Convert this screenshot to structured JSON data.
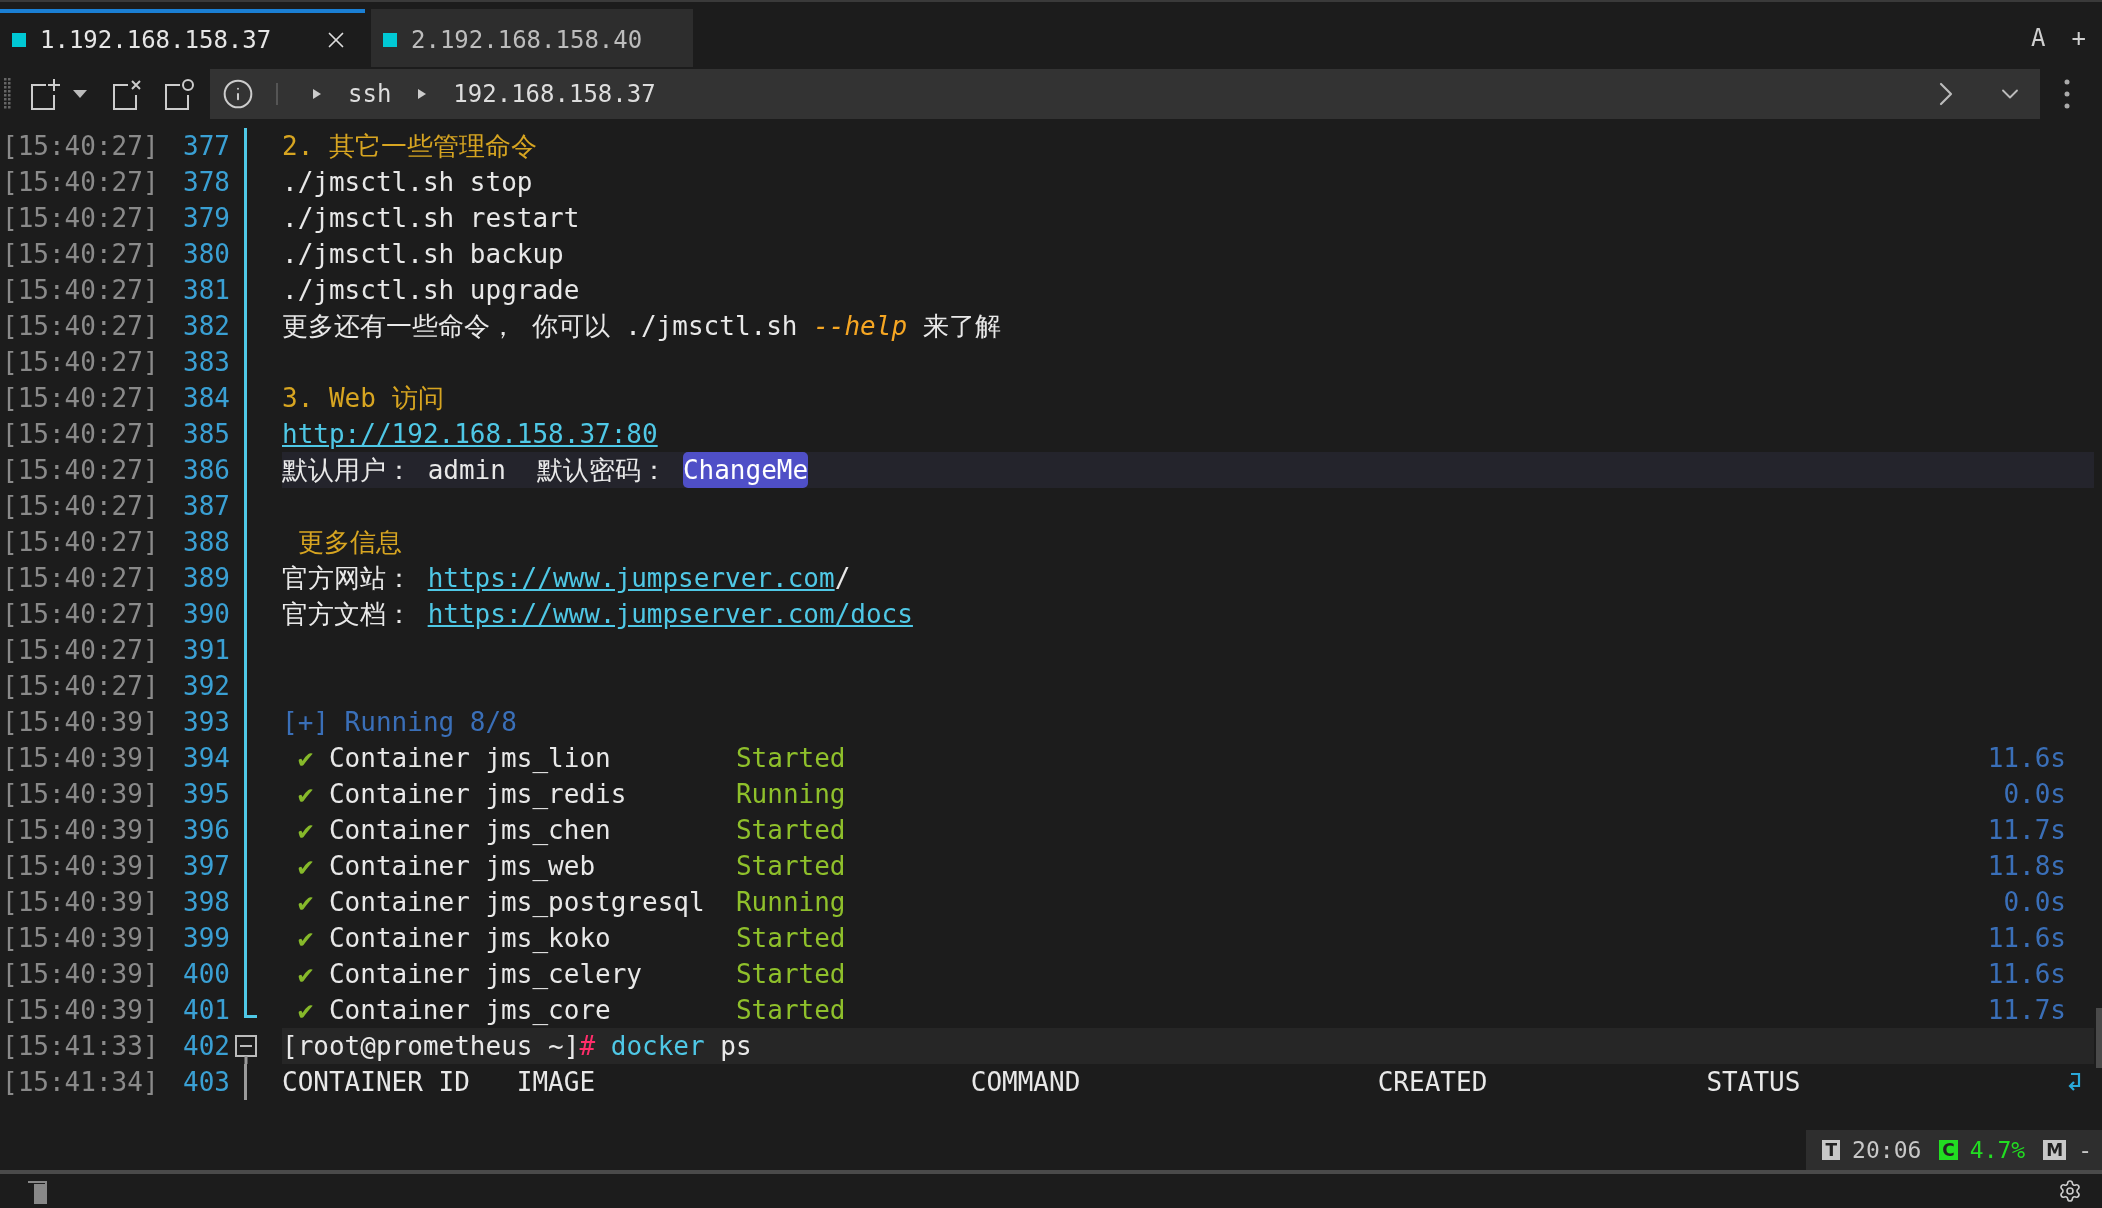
{
  "tabs": [
    {
      "label": "1.192.168.158.37",
      "selected": true,
      "closable": true
    },
    {
      "label": "2.192.168.158.40",
      "selected": false,
      "closable": false
    }
  ],
  "tab_actions": [
    "A",
    "+"
  ],
  "breadcrumb": [
    "ssh",
    "192.168.158.37"
  ],
  "lines": [
    {
      "time": "[15:40:27]",
      "number": "377",
      "kind": "text",
      "segments": [
        {
          "kind": "heading",
          "text": "2. 其它一些管理命令"
        }
      ]
    },
    {
      "time": "[15:40:27]",
      "number": "378",
      "kind": "text",
      "segments": [
        {
          "kind": "plain",
          "text": "./jmsctl.sh stop"
        }
      ]
    },
    {
      "time": "[15:40:27]",
      "number": "379",
      "kind": "text",
      "segments": [
        {
          "kind": "plain",
          "text": "./jmsctl.sh restart"
        }
      ]
    },
    {
      "time": "[15:40:27]",
      "number": "380",
      "kind": "text",
      "segments": [
        {
          "kind": "plain",
          "text": "./jmsctl.sh backup"
        }
      ]
    },
    {
      "time": "[15:40:27]",
      "number": "381",
      "kind": "text",
      "segments": [
        {
          "kind": "plain",
          "text": "./jmsctl.sh upgrade"
        }
      ]
    },
    {
      "time": "[15:40:27]",
      "number": "382",
      "kind": "text",
      "segments": [
        {
          "kind": "plain",
          "text": "更多还有一些命令， 你可以 ./jmsctl.sh "
        },
        {
          "kind": "flag",
          "text": "--help"
        },
        {
          "kind": "plain",
          "text": " 来了解"
        }
      ]
    },
    {
      "time": "[15:40:27]",
      "number": "383",
      "kind": "text"
    },
    {
      "time": "[15:40:27]",
      "number": "384",
      "kind": "text",
      "segments": [
        {
          "kind": "heading",
          "text": "3. Web 访问"
        }
      ]
    },
    {
      "time": "[15:40:27]",
      "number": "385",
      "kind": "text",
      "segments": [
        {
          "kind": "link",
          "text": "http://192.168.158.37:80"
        }
      ]
    },
    {
      "time": "[15:40:27]",
      "number": "386",
      "kind": "text",
      "highlighted": true,
      "segments": [
        {
          "kind": "plain",
          "text": "默认用户： admin  默认密码： "
        },
        {
          "kind": "selection",
          "text": "ChangeMe"
        }
      ]
    },
    {
      "time": "[15:40:27]",
      "number": "387",
      "kind": "text"
    },
    {
      "time": "[15:40:27]",
      "number": "388",
      "kind": "text",
      "segments": [
        {
          "kind": "heading",
          "text": " 更多信息"
        }
      ]
    },
    {
      "time": "[15:40:27]",
      "number": "389",
      "kind": "text",
      "segments": [
        {
          "kind": "plain",
          "text": "官方网站： "
        },
        {
          "kind": "link",
          "text": "https://www.jumpserver.com"
        },
        {
          "kind": "plain",
          "text": "/"
        }
      ]
    },
    {
      "time": "[15:40:27]",
      "number": "390",
      "kind": "text",
      "segments": [
        {
          "kind": "plain",
          "text": "官方文档： "
        },
        {
          "kind": "link",
          "text": "https://www.jumpserver.com/docs"
        }
      ]
    },
    {
      "time": "[15:40:27]",
      "number": "391",
      "kind": "text"
    },
    {
      "time": "[15:40:27]",
      "number": "392",
      "kind": "text"
    },
    {
      "time": "[15:40:39]",
      "number": "393",
      "kind": "text",
      "segments": [
        {
          "kind": "progress",
          "text": "[+] Running 8/8"
        }
      ]
    },
    {
      "time": "[15:40:39]",
      "number": "394",
      "kind": "container",
      "mark": "✔",
      "name": "Container jms_lion",
      "status": "Started",
      "duration": "11.6s"
    },
    {
      "time": "[15:40:39]",
      "number": "395",
      "kind": "container",
      "mark": "✔",
      "name": "Container jms_redis",
      "status": "Running",
      "duration": "0.0s"
    },
    {
      "time": "[15:40:39]",
      "number": "396",
      "kind": "container",
      "mark": "✔",
      "name": "Container jms_chen",
      "status": "Started",
      "duration": "11.7s"
    },
    {
      "time": "[15:40:39]",
      "number": "397",
      "kind": "container",
      "mark": "✔",
      "name": "Container jms_web",
      "status": "Started",
      "duration": "11.8s"
    },
    {
      "time": "[15:40:39]",
      "number": "398",
      "kind": "container",
      "mark": "✔",
      "name": "Container jms_postgresql",
      "status": "Running",
      "duration": "0.0s"
    },
    {
      "time": "[15:40:39]",
      "number": "399",
      "kind": "container",
      "mark": "✔",
      "name": "Container jms_koko",
      "status": "Started",
      "duration": "11.6s"
    },
    {
      "time": "[15:40:39]",
      "number": "400",
      "kind": "container",
      "mark": "✔",
      "name": "Container jms_celery",
      "status": "Started",
      "duration": "11.6s"
    },
    {
      "time": "[15:40:39]",
      "number": "401",
      "kind": "container",
      "mark": "✔",
      "name": "Container jms_core",
      "status": "Started",
      "duration": "11.7s"
    },
    {
      "time": "[15:41:33]",
      "number": "402",
      "kind": "prompt",
      "expanded": true,
      "highlighted": true,
      "prompt": "[root@prometheus ~]",
      "symbol": "#",
      "command": "docker",
      "args": " ps"
    },
    {
      "time": "[15:41:34]",
      "number": "403",
      "kind": "columns",
      "wrapped": true,
      "cells": [
        "CONTAINER ID",
        "IMAGE",
        "COMMAND",
        "CREATED",
        "STATUS"
      ]
    }
  ],
  "status": [
    {
      "badge": "T",
      "value": "20:06",
      "color": "#c8c8c8"
    },
    {
      "badge": "C",
      "value": "4.7%",
      "color": "#22dd22"
    },
    {
      "badge": "M",
      "value": "-",
      "color": "#c8c8c8"
    }
  ]
}
